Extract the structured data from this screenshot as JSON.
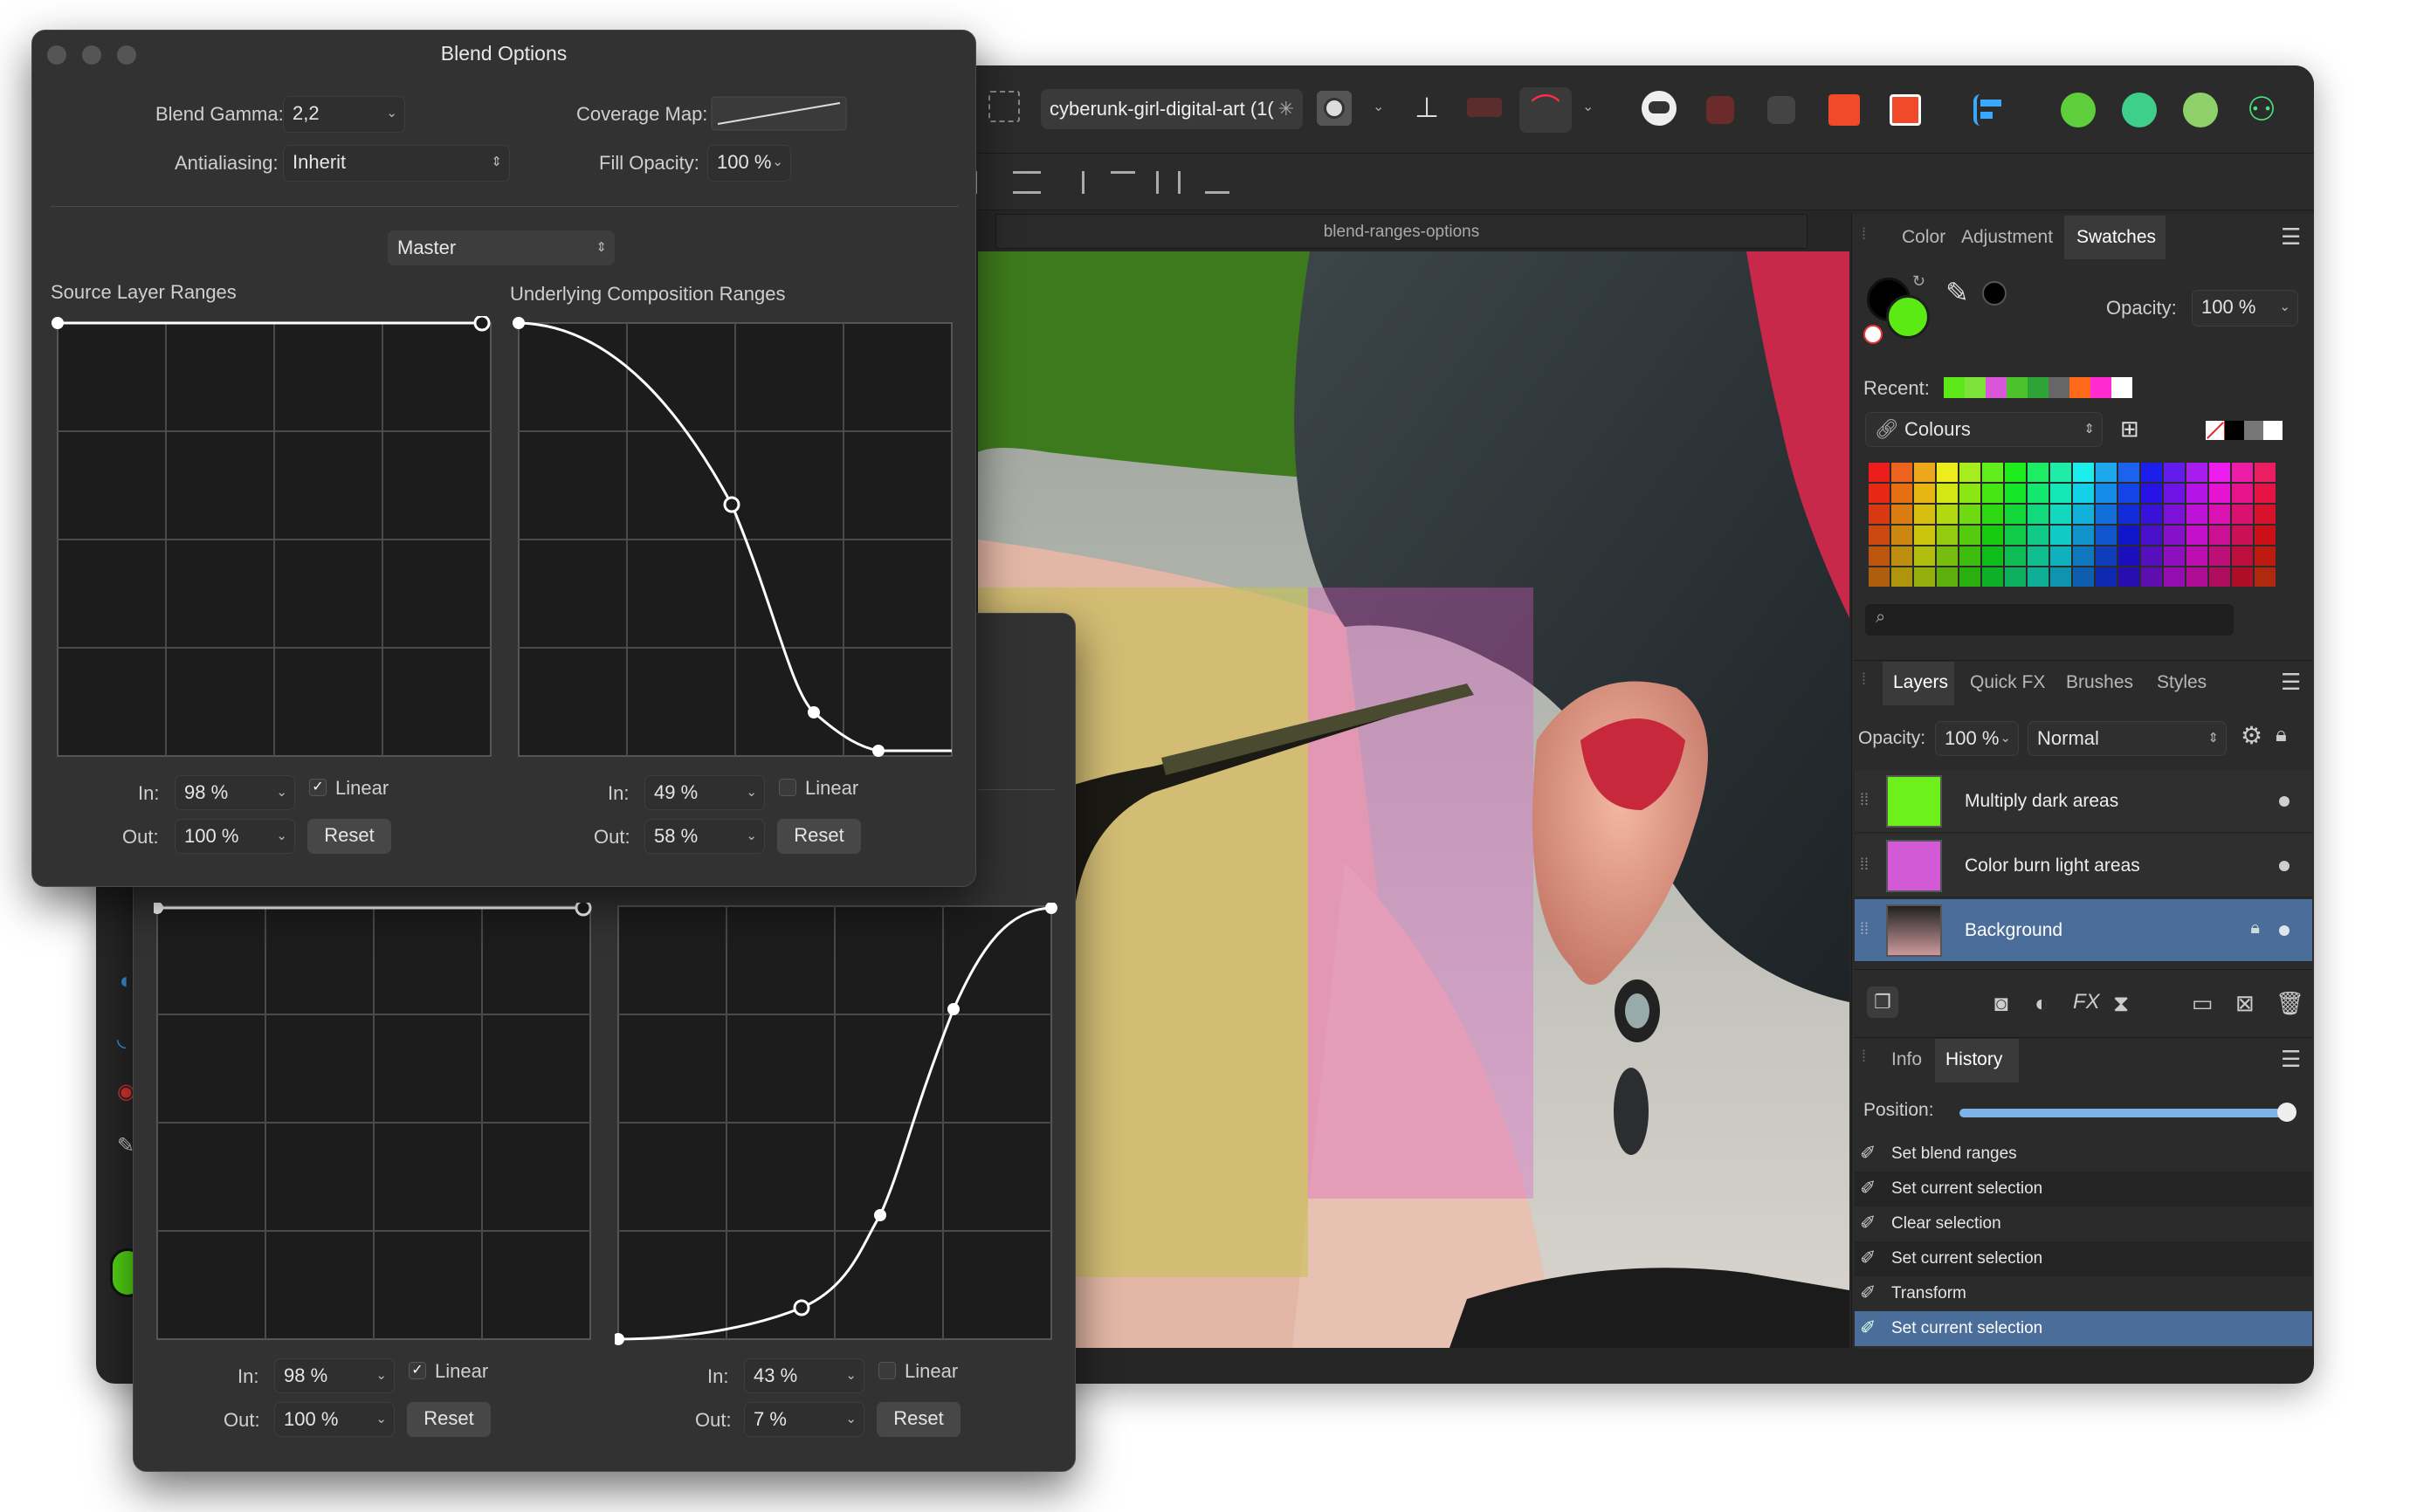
{
  "document": {
    "title": "cyberunk-girl-digital-art (1(",
    "tab_title": "blend-ranges-options"
  },
  "blend_dialog": {
    "title": "Blend Options",
    "blend_gamma_label": "Blend Gamma:",
    "blend_gamma_value": "2,2",
    "coverage_map_label": "Coverage Map:",
    "antialiasing_label": "Antialiasing:",
    "antialiasing_value": "Inherit",
    "fill_opacity_label": "Fill Opacity:",
    "fill_opacity_value": "100 %",
    "channel": "Master",
    "source_title": "Source Layer Ranges",
    "underlying_title": "Underlying Composition Ranges",
    "source": {
      "in_label": "In:",
      "in": "98 %",
      "out_label": "Out:",
      "out": "100 %",
      "linear_label": "Linear",
      "linear": true,
      "reset": "Reset"
    },
    "underlying": {
      "in_label": "In:",
      "in": "49 %",
      "out_label": "Out:",
      "out": "58 %",
      "linear_label": "Linear",
      "linear": false,
      "reset": "Reset"
    }
  },
  "blend_dialog_back": {
    "source": {
      "in_label": "In:",
      "in": "98 %",
      "out_label": "Out:",
      "out": "100 %",
      "linear_label": "Linear",
      "linear": true,
      "reset": "Reset"
    },
    "underlying": {
      "in_label": "In:",
      "in": "43 %",
      "out_label": "Out:",
      "out": "7 %",
      "linear_label": "Linear",
      "linear": false,
      "reset": "Reset"
    }
  },
  "color_panel": {
    "tabs": [
      "Color",
      "Adjustment",
      "Swatches"
    ],
    "active_tab": "Swatches",
    "opacity_label": "Opacity:",
    "opacity_value": "100 %",
    "recent_label": "Recent:",
    "recent_colors": [
      "#5ee81a",
      "#7be33a",
      "#d956d8",
      "#4bc22a",
      "#2ea336",
      "#666666",
      "#ff6a1a",
      "#ff2ad0",
      "#ffffff",
      "#2b2b2b"
    ],
    "palette_name": "Colours",
    "fill_color": "#5bea14",
    "stroke_color": "#000000"
  },
  "layers_panel": {
    "tabs": [
      "Layers",
      "Quick FX",
      "Brushes",
      "Styles"
    ],
    "active_tab": "Layers",
    "opacity_label": "Opacity:",
    "opacity_value": "100 %",
    "blend_mode": "Normal",
    "layers": [
      {
        "name": "Multiply dark areas",
        "thumb": "#6ef01a",
        "selected": false
      },
      {
        "name": "Color burn light areas",
        "thumb": "#d35ad6",
        "selected": false
      },
      {
        "name": "Background",
        "thumb": "photo",
        "selected": true
      }
    ]
  },
  "history_panel": {
    "tabs": [
      "Info",
      "History"
    ],
    "active_tab": "History",
    "position_label": "Position:",
    "items": [
      "Set blend ranges",
      "Set current selection",
      "Clear selection",
      "Set current selection",
      "Transform",
      "Set current selection"
    ],
    "selected_index": 5
  }
}
